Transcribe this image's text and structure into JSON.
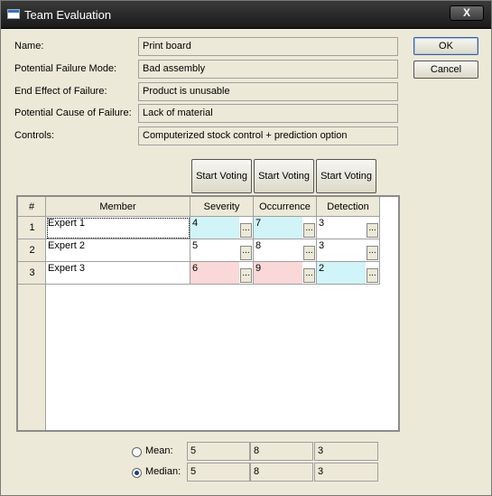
{
  "window": {
    "title": "Team Evaluation",
    "close_glyph": "X"
  },
  "buttons": {
    "ok": "OK",
    "cancel": "Cancel"
  },
  "fields": [
    {
      "label": "Name:",
      "value": "Print board"
    },
    {
      "label": "Potential Failure Mode:",
      "value": "Bad assembly"
    },
    {
      "label": "End Effect of Failure:",
      "value": "Product is unusable"
    },
    {
      "label": "Potential Cause of Failure:",
      "value": "Lack of material"
    },
    {
      "label": "Controls:",
      "value": "Computerized stock control + prediction option"
    }
  ],
  "vote_buttons": [
    "Start Voting",
    "Start Voting",
    "Start Voting"
  ],
  "grid": {
    "headers": [
      "#",
      "Member",
      "Severity",
      "Occurrence",
      "Detection"
    ],
    "ellipsis": "...",
    "rows": [
      {
        "num": "1",
        "member": "Expert 1",
        "severity": "4",
        "occurrence": "7",
        "detection": "3"
      },
      {
        "num": "2",
        "member": "Expert 2",
        "severity": "5",
        "occurrence": "8",
        "detection": "3"
      },
      {
        "num": "3",
        "member": "Expert 3",
        "severity": "6",
        "occurrence": "9",
        "detection": "2"
      }
    ]
  },
  "summary": {
    "mean": {
      "label": "Mean:",
      "selected": false,
      "values": [
        "5",
        "8",
        "3"
      ]
    },
    "median": {
      "label": "Median:",
      "selected": true,
      "values": [
        "5",
        "8",
        "3"
      ]
    }
  },
  "colors": {
    "blue_highlight": "#d0f4f8",
    "pink_highlight": "#fbd8d8"
  }
}
